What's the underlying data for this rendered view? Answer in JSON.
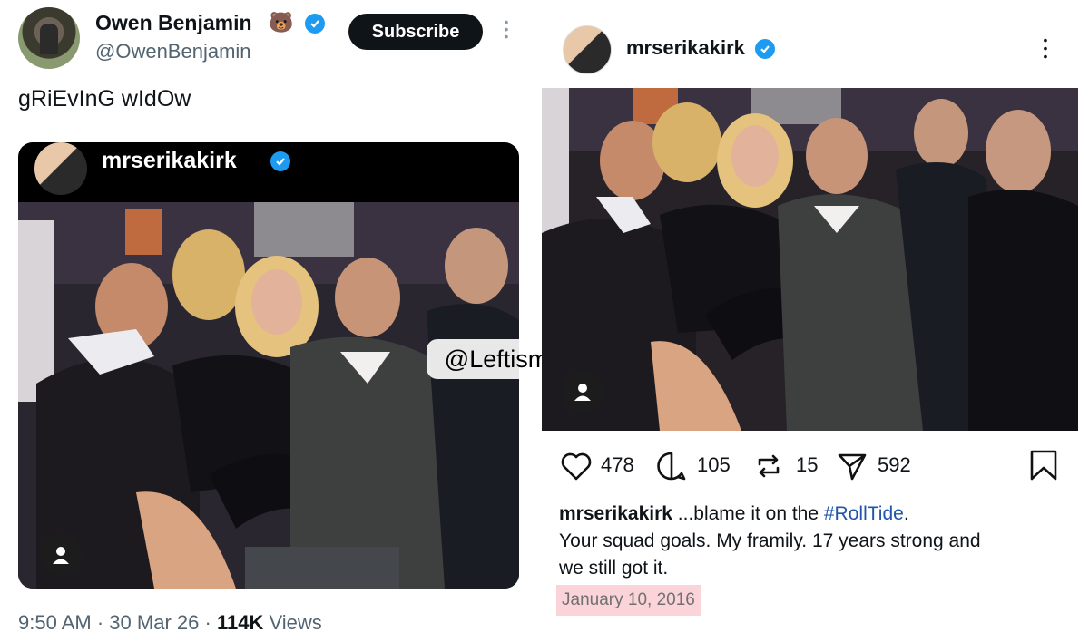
{
  "tweet": {
    "author_name": "Owen Benjamin",
    "emoji": "🐻",
    "handle": "@OwenBenjamin",
    "subscribe_label": "Subscribe",
    "text": "gRiEvInG wIdOw",
    "embedded_username": "mrserikakirk",
    "watermark": "@LeftismForU",
    "time": "9:50 AM",
    "date": "30 Mar 26",
    "views_count": "114K",
    "views_label": "Views"
  },
  "instagram": {
    "username": "mrserikakirk",
    "likes": "478",
    "comments": "105",
    "reposts": "15",
    "shares": "592",
    "caption_user": "mrserikakirk",
    "caption_prefix": "...blame it on the ",
    "caption_tag": "#RollTide",
    "caption_suffix": ".",
    "caption_line2": "Your squad goals. My framily. 17 years strong and",
    "caption_line3": "we still got it.",
    "date": "January 10, 2016"
  },
  "colors": {
    "verified_blue": "#1d9bf0",
    "subscribe_bg": "#0f1419",
    "hashtag": "#2255aa",
    "date_highlight": "#fad4d8"
  },
  "icons": [
    "bear-emoji",
    "verified-badge-icon",
    "more-dots-icon",
    "heart-icon",
    "comment-icon",
    "repost-icon",
    "share-icon",
    "bookmark-icon",
    "person-tag-icon"
  ]
}
